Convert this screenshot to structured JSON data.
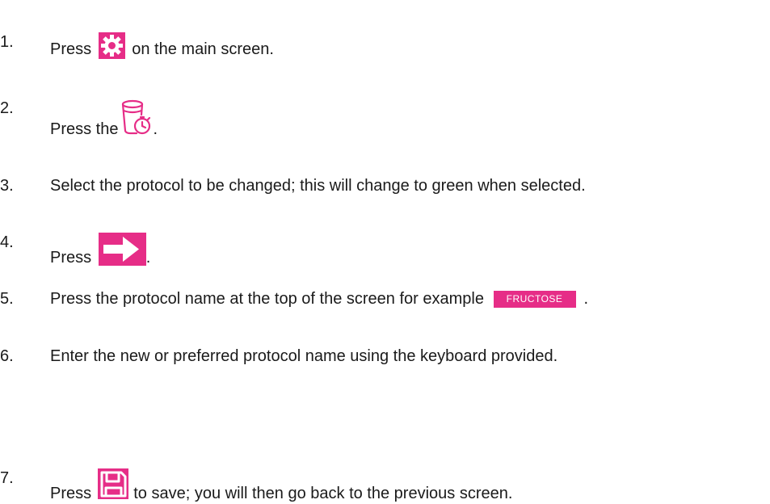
{
  "steps": [
    {
      "num": "1.",
      "pre": "Press",
      "post": "on the main screen.",
      "icon": "gear-icon"
    },
    {
      "num": "2.",
      "pre": "Press the",
      "post": ".",
      "icon": "cup-timer-icon"
    },
    {
      "num": "3.",
      "text": "Select the protocol to be changed; this will change to green when selected."
    },
    {
      "num": "4.",
      "pre": "Press",
      "post": ".",
      "icon": "arrow-right-icon"
    },
    {
      "num": "5.",
      "pre": "Press the protocol name at the top of the screen for example",
      "post": ".",
      "button_label": "FRUCTOSE"
    },
    {
      "num": "6.",
      "text": "Enter the new or preferred protocol name using the keyboard provided."
    },
    {
      "num": "7.",
      "pre": "Press",
      "post": "to save; you will then go back to the previous screen.",
      "icon": "save-icon"
    }
  ],
  "colors": {
    "accent": "#e62d87",
    "text": "#1a1a1a"
  }
}
